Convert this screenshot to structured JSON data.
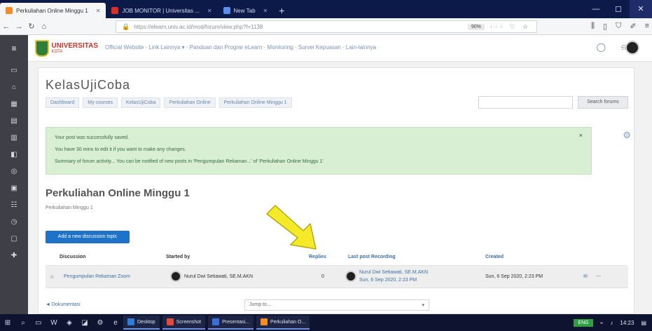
{
  "browser": {
    "tabs": [
      {
        "label": "Perkuliahan Online Minggu 1",
        "active": true,
        "favicon_color": "#f28c28"
      },
      {
        "label": "JOB MONITOR | Universitas ...",
        "active": false,
        "favicon_color": "#d93025"
      },
      {
        "label": "New Tab",
        "active": false,
        "favicon_color": "#5b8def"
      }
    ],
    "new_tab_label": "+",
    "window_controls": {
      "minimize": "—",
      "maximize": "☐",
      "close": "✕"
    },
    "url": "https://elearn.univ.ac.id/mod/forum/view.php?f=1138",
    "zoom": "90%",
    "page_actions": "··· ♡ ☆"
  },
  "header": {
    "logo_text": "UNIVERSITAS",
    "logo_subtext": "KOTA",
    "top_nav": "Official Website · Link Lainnya ▾ · Panduan dan Prograr eLearn · Monitoring · Survei Kepuasan · Lain-lainnya"
  },
  "sidebar": {
    "icons": [
      "menu-icon",
      "dashboard-icon",
      "home-icon",
      "calendar-icon",
      "files-icon",
      "grades-icon",
      "course-icon",
      "badges-icon",
      "competency-icon",
      "participants-icon",
      "reports-icon",
      "add-icon"
    ]
  },
  "course": {
    "title": "KelasUjiCoba",
    "breadcrumb": [
      "Dashboard",
      "My courses",
      "KelasUjiCoba",
      "Perkuliahan Online",
      "Perkuliahan Online Minggu 1"
    ],
    "search_placeholder": "",
    "search_button": "Search forums"
  },
  "alert": {
    "lines": [
      "Your post was successfully saved.",
      "You have 30 mins to edit it if you want to make any changes.",
      "Summary of forum activity... You can be notified of new posts in 'Pengumpulan Rekaman...' of 'Perkuliahan Online Minggu 1'"
    ],
    "close": "×"
  },
  "forum": {
    "title": "Perkuliahan Online Minggu 1",
    "description": "Perkuliahan Minggu 1",
    "add_button": "Add a new discussion topic"
  },
  "table": {
    "headers": {
      "discussion": "Discussion",
      "started_by": "Started by",
      "replies": "Replies",
      "last_post": "Last post Recording",
      "created": "Created"
    },
    "rows": [
      {
        "discussion": "Pengumpulan Rekaman Zoom",
        "started_by": "Nurul Dwi Setiawati, SE.M.AKN",
        "replies": "0",
        "last_post_name": "Nurul Dwi Setiawati, SE.M.AKN",
        "last_post_date": "Sun, 6 Sep 2020, 2:23 PM",
        "created": "Sun, 6 Sep 2020, 2:23 PM",
        "subscribe_icon": "✉",
        "menu_icon": "⋯"
      }
    ]
  },
  "footer_nav": {
    "prev_link": "◄ Dokumentasi",
    "jump_label": "Jump to...",
    "jump_caret": "▾"
  },
  "taskbar": {
    "apps": [
      {
        "label": "Desktop",
        "color": "#2f7bd8"
      },
      {
        "label": "Screenshot",
        "color": "#e04a3a"
      },
      {
        "label": "Presentasi...",
        "color": "#3a6fd8"
      },
      {
        "label": "Perkuliahan O...",
        "color": "#f28c28"
      }
    ],
    "tray_label": "ENG",
    "clock": "14:23"
  }
}
